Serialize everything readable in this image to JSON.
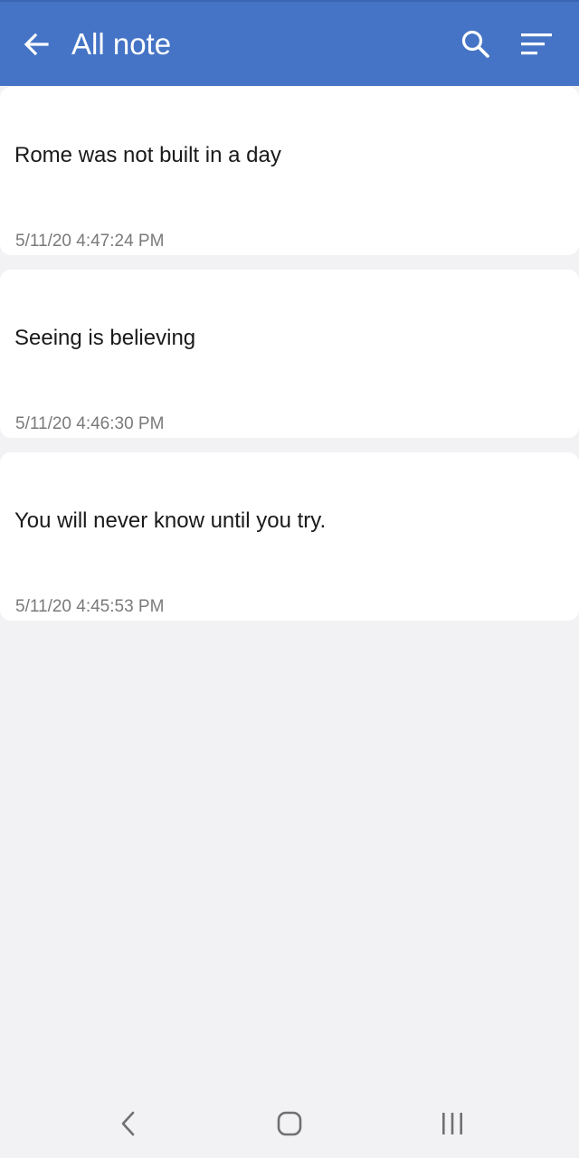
{
  "header": {
    "title": "All note",
    "back_icon": "arrow-left-icon",
    "search_icon": "search-icon",
    "sort_icon": "sort-icon",
    "background_color": "#4574c6"
  },
  "notes": [
    {
      "text": "Rome was not built in a day",
      "date": "5/11/20 4:47:24 PM"
    },
    {
      "text": "Seeing is believing",
      "date": "5/11/20 4:46:30 PM"
    },
    {
      "text": "You will never know until you try.",
      "date": "5/11/20 4:45:53 PM"
    }
  ],
  "system_nav": {
    "back_icon": "nav-back-icon",
    "home_icon": "nav-home-icon",
    "recents_icon": "nav-recents-icon"
  }
}
